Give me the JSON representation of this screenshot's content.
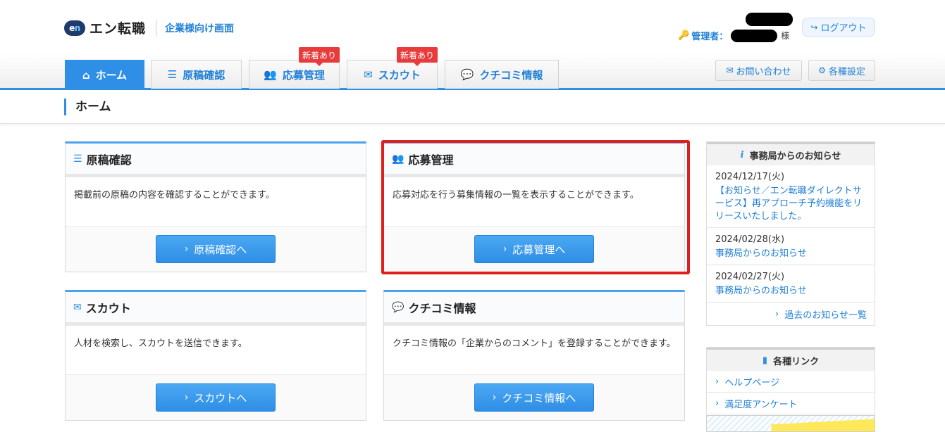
{
  "header": {
    "logo_badge_e": "e",
    "logo_badge_n": "n",
    "logo_text": "エン転職",
    "subtitle": "企業様向け画面",
    "admin_label": "管理者：",
    "honorific": "様",
    "logout_label": "ログアウト"
  },
  "nav": {
    "tabs": [
      {
        "label": "ホーム",
        "icon": "home-icon",
        "active": true
      },
      {
        "label": "原稿確認",
        "icon": "stack-icon",
        "active": false
      },
      {
        "label": "応募管理",
        "icon": "users-icon",
        "active": false,
        "badge": "新着あり"
      },
      {
        "label": "スカウト",
        "icon": "mail-icon",
        "active": false,
        "badge": "新着あり"
      },
      {
        "label": "クチコミ情報",
        "icon": "chat-icon",
        "active": false
      }
    ],
    "contact_label": "お問い合わせ",
    "settings_label": "各種設定"
  },
  "page": {
    "title": "ホーム"
  },
  "cards": [
    {
      "title": "原稿確認",
      "desc": "掲載前の原稿の内容を確認することができます。",
      "button": "原稿確認へ"
    },
    {
      "title": "応募管理",
      "desc": "応募対応を行う募集情報の一覧を表示することができます。",
      "button": "応募管理へ"
    },
    {
      "title": "スカウト",
      "desc": "人材を検索し、スカウトを送信できます。",
      "button": "スカウトへ"
    },
    {
      "title": "クチコミ情報",
      "desc": "クチコミ情報の「企業からのコメント」を登録することができます。",
      "button": "クチコミ情報へ"
    }
  ],
  "news": {
    "heading_icon": "i",
    "heading": "事務局からのお知らせ",
    "items": [
      {
        "date": "2024/12/17(火)",
        "text": "【お知らせ／エン転職ダイレクトサービス】再アプローチ予約機能をリリースいたしました。"
      },
      {
        "date": "2024/02/28(水)",
        "text": "事務局からのお知らせ"
      },
      {
        "date": "2024/02/27(火)",
        "text": "事務局からのお知らせ"
      }
    ],
    "past_link": "過去のお知らせ一覧"
  },
  "links": {
    "heading": "各種リンク",
    "items": [
      "ヘルプページ",
      "満足度アンケート"
    ]
  },
  "colors": {
    "accent": "#2f8ee6",
    "badge": "#e83b3b",
    "highlight": "#e01e1e"
  }
}
